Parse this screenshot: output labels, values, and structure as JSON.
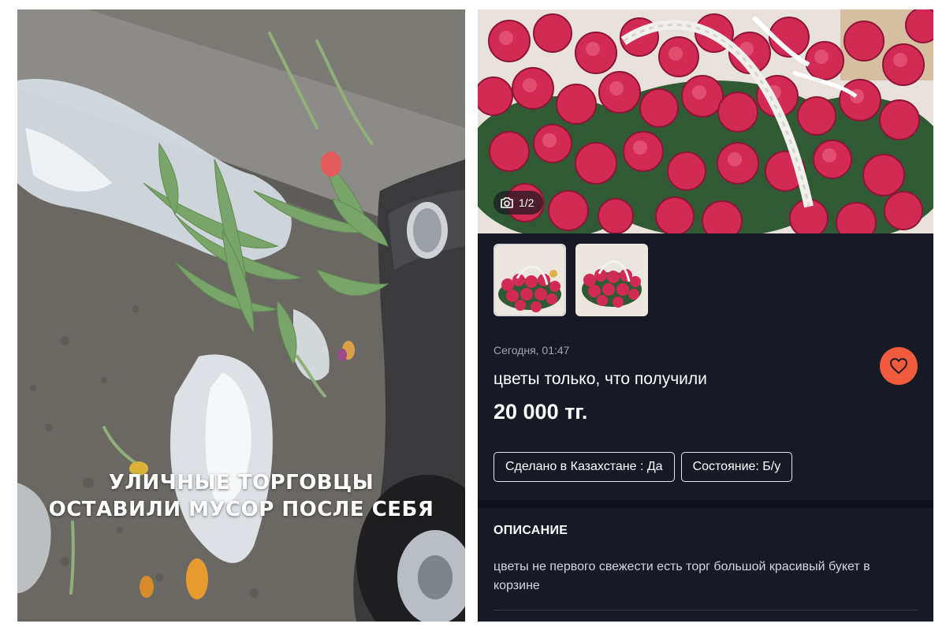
{
  "left_photo": {
    "caption_lines": [
      "УЛИЧНЫЕ ТОРГОВЦЫ",
      "ОСТАВИЛИ МУСОР ПОСЛЕ СЕБЯ"
    ]
  },
  "listing": {
    "photo_counter": "1/2",
    "photo_progress": {
      "current": 1,
      "total": 2
    },
    "thumbnails": [
      {
        "active": true
      },
      {
        "active": false
      }
    ],
    "date": "Сегодня, 01:47",
    "title": "цветы только, что получили",
    "price": "20 000 тг.",
    "tags": [
      "Сделано в Казахстане : Да",
      "Состояние: Б/у"
    ],
    "description_heading": "ОПИСАНИЕ",
    "description": "цветы не первого свежести есть торг большой красивый букет в корзине"
  },
  "icons": {
    "camera": "camera-icon",
    "favorite": "heart-icon"
  },
  "colors": {
    "panel_bg": "#171a25",
    "favorite_accent": "#f05a3d",
    "rose": "#d12a55"
  }
}
